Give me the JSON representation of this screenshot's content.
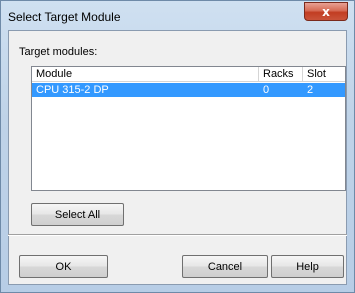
{
  "window": {
    "title": "Select Target Module",
    "close_glyph": "x"
  },
  "target_label": "Target modules:",
  "table": {
    "columns": [
      "Module",
      "Racks",
      "Slot"
    ],
    "rows": [
      {
        "module": "CPU 315-2 DP",
        "racks": "0",
        "slot": "2",
        "selected": true
      }
    ]
  },
  "buttons": {
    "select_all": "Select All",
    "ok": "OK",
    "cancel": "Cancel",
    "help": "Help"
  },
  "colors": {
    "selection": "#3399ff",
    "close_button": "#c9533a"
  }
}
